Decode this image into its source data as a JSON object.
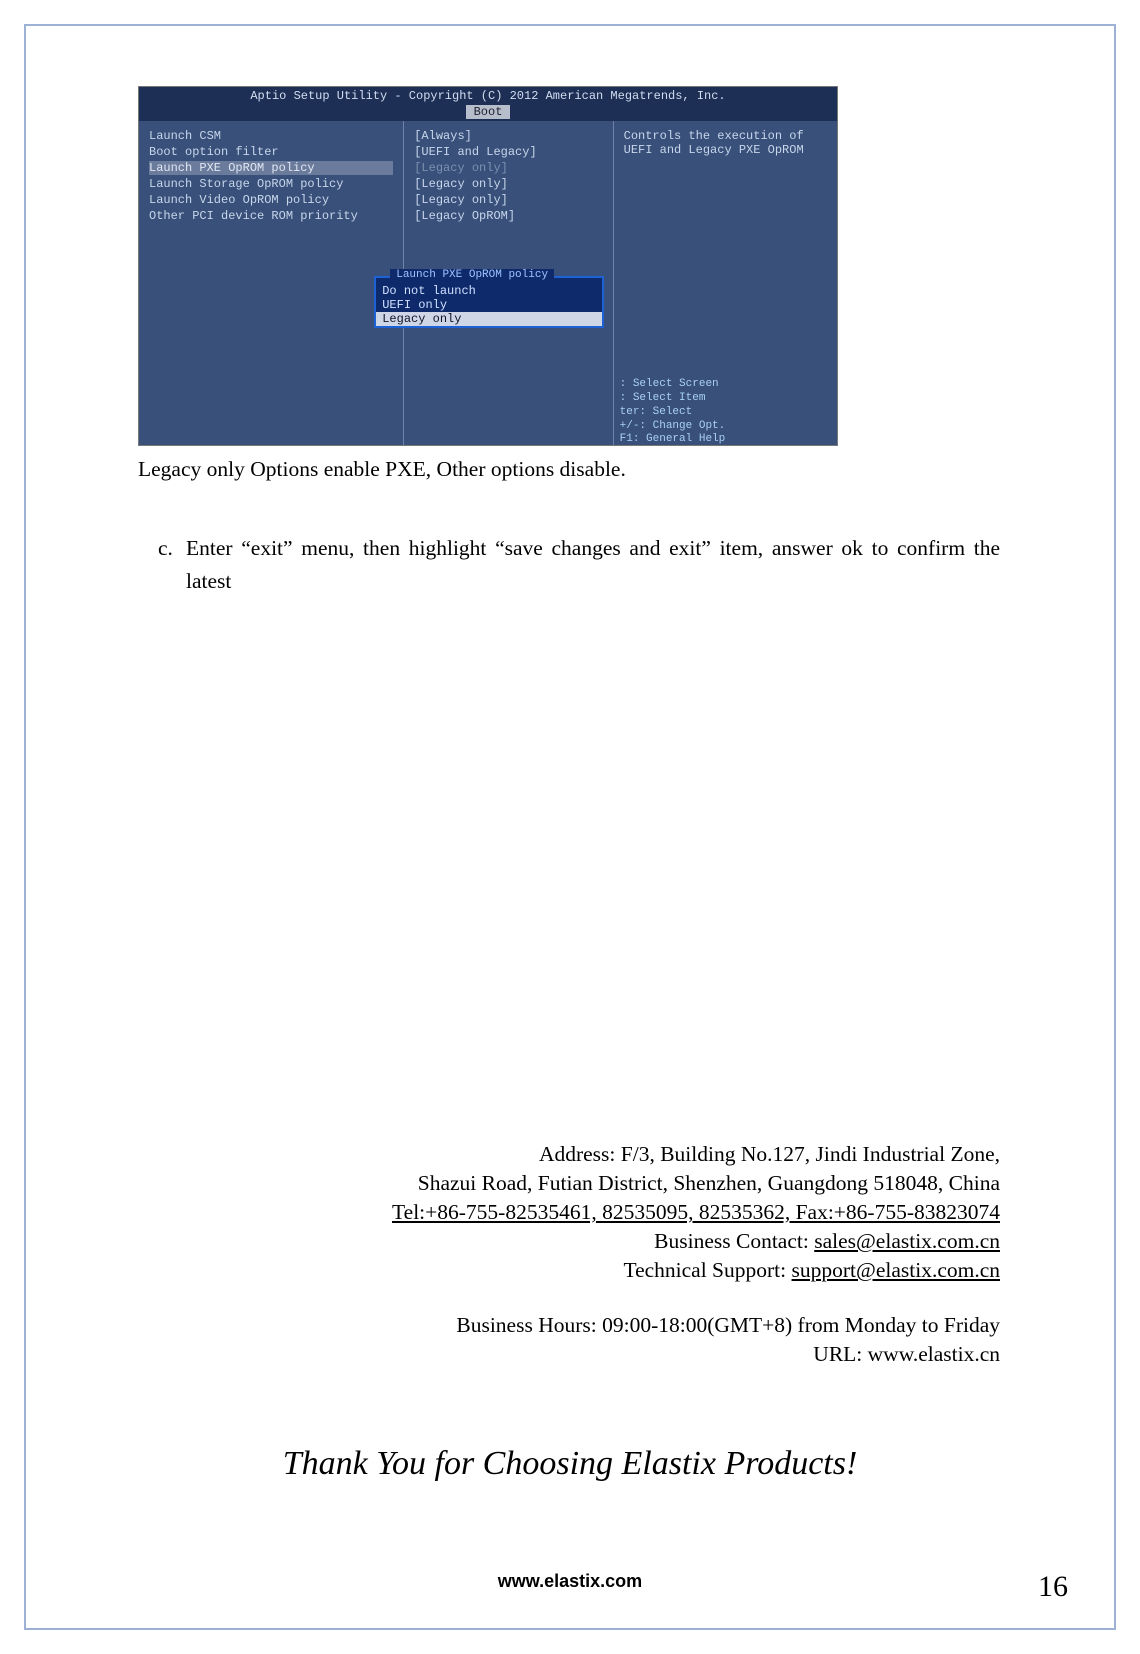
{
  "bios": {
    "title": "Aptio Setup Utility - Copyright (C) 2012 American Megatrends, Inc.",
    "tab": "Boot",
    "left_items": [
      {
        "label": "Launch CSM",
        "sel": false,
        "dim": false
      },
      {
        "label": "Boot option filter",
        "sel": false,
        "dim": false
      },
      {
        "label": "Launch PXE OpROM policy",
        "sel": true,
        "dim": false
      },
      {
        "label": "Launch Storage OpROM policy",
        "sel": false,
        "dim": false
      },
      {
        "label": "Launch Video OpROM policy",
        "sel": false,
        "dim": false
      },
      {
        "label": "",
        "sel": false,
        "dim": false
      },
      {
        "label": "Other PCI device ROM priority",
        "sel": false,
        "dim": false
      }
    ],
    "mid_values": [
      "[Always]",
      "[UEFI and Legacy]",
      "[Legacy only]",
      "[Legacy only]",
      "[Legacy only]",
      "",
      "[Legacy OpROM]"
    ],
    "right_desc": "Controls the execution of UEFI and Legacy PXE OpROM",
    "popup_title": "Launch PXE OpROM policy",
    "popup_opts": [
      {
        "t": "Do not launch",
        "sel": false
      },
      {
        "t": "UEFI only",
        "sel": false
      },
      {
        "t": "Legacy only",
        "sel": true
      }
    ],
    "help": [
      ": Select Screen",
      ": Select Item",
      "ter: Select",
      "+/-: Change Opt.",
      "F1: General Help"
    ]
  },
  "caption": "Legacy only Options enable PXE, Other options disable.",
  "step_marker": "c.",
  "step_text": "Enter “exit” menu, then highlight “save changes and exit” item, answer ok to confirm the latest",
  "contact": {
    "addr1": "Address: F/3, Building No.127, Jindi Industrial Zone,",
    "addr2": "Shazui Road, Futian District, Shenzhen, Guangdong 518048, China",
    "telfax": "Tel:+86-755-82535461, 82535095, 82535362, Fax:+86-755-83823074",
    "biz_label": "Business Contact: ",
    "biz_email": "sales@elastix.com.cn",
    "tech_label": "Technical Support: ",
    "tech_email": "support@elastix.com.cn",
    "hours": "Business Hours: 09:00-18:00(GMT+8) from Monday to Friday",
    "url": "URL: www.elastix.cn"
  },
  "thanks": "Thank You for Choosing Elastix Products!",
  "footer_url": "www.elastix.com",
  "page_num": "16"
}
